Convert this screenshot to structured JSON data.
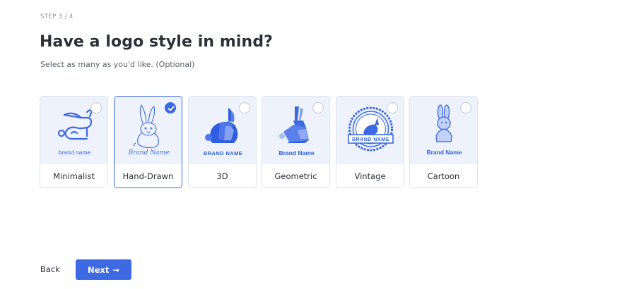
{
  "step": "STEP 3 / 4",
  "title": "Have a logo style in mind?",
  "subtitle": "Select as many as you'd like. (Optional)",
  "styles": [
    {
      "label": "Minimalist",
      "brand_text": "brand name",
      "selected": false
    },
    {
      "label": "Hand-Drawn",
      "brand_text": "Brand Name",
      "selected": true
    },
    {
      "label": "3D",
      "brand_text": "BRAND NAME",
      "selected": false
    },
    {
      "label": "Geometric",
      "brand_text": "Brand Name",
      "selected": false
    },
    {
      "label": "Vintage",
      "brand_text": "BRAND NAME",
      "selected": false
    },
    {
      "label": "Cartoon",
      "brand_text": "Brand Name",
      "selected": false
    }
  ],
  "footer": {
    "back_label": "Back",
    "next_label": "Next",
    "next_arrow": "→"
  },
  "colors": {
    "accent": "#3d6ae3",
    "card_bg": "#eef2fd",
    "text": "#2b2f38"
  },
  "icons": [
    "rabbit-outline-icon",
    "rabbit-sketch-icon",
    "rabbit-3d-icon",
    "rabbit-geometric-icon",
    "rabbit-badge-icon",
    "rabbit-cartoon-icon",
    "check-icon",
    "arrow-right-icon"
  ]
}
